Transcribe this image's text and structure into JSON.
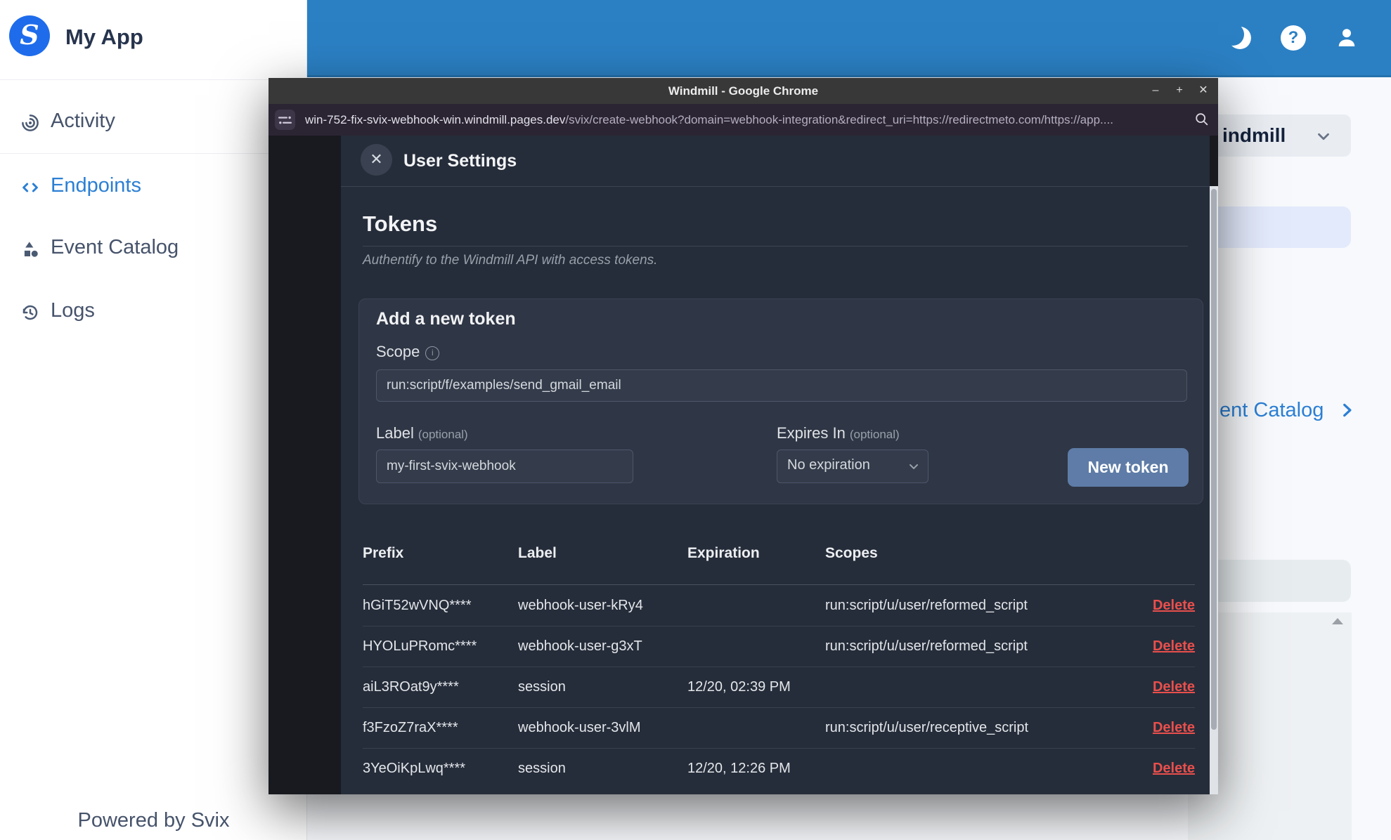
{
  "sidebar": {
    "app_name": "My App",
    "items": [
      {
        "label": "Activity",
        "icon": "activity-icon",
        "active": false
      },
      {
        "label": "Endpoints",
        "icon": "endpoints-icon",
        "active": true
      },
      {
        "label": "Event Catalog",
        "icon": "event-catalog-icon",
        "active": false
      },
      {
        "label": "Logs",
        "icon": "logs-icon",
        "active": false
      }
    ],
    "footer": "Powered by Svix"
  },
  "topbar": {
    "icons": [
      "moon-icon",
      "help-icon",
      "user-icon"
    ],
    "help_glyph": "?"
  },
  "background_page": {
    "workspace_label": "indmill",
    "catalog_link": "ent Catalog"
  },
  "window": {
    "title": "Windmill - Google Chrome",
    "controls": {
      "minimize": "–",
      "maximize": "+",
      "close": "✕"
    },
    "url": {
      "domain": "win-752-fix-svix-webhook-win.windmill.pages.dev",
      "path": "/svix/create-webhook?domain=webhook-integration&redirect_uri=https://redirectmeto.com/https://app...."
    }
  },
  "modal": {
    "title": "User Settings",
    "close_glyph": "✕",
    "section": {
      "heading": "Tokens",
      "subtitle": "Authentify to the Windmill API with access tokens."
    },
    "add_token": {
      "heading": "Add a new token",
      "scope_label": "Scope",
      "info_glyph": "i",
      "scope_value": "run:script/f/examples/send_gmail_email",
      "label_label": "Label",
      "label_optional": "(optional)",
      "label_value": "my-first-svix-webhook",
      "expires_label": "Expires In",
      "expires_optional": "(optional)",
      "expires_value": "No expiration",
      "submit_label": "New token"
    },
    "table": {
      "headers": [
        "Prefix",
        "Label",
        "Expiration",
        "Scopes"
      ],
      "delete_label": "Delete",
      "rows": [
        {
          "prefix": "hGiT52wVNQ****",
          "label": "webhook-user-kRy4",
          "expiration": "",
          "scopes": "run:script/u/user/reformed_script"
        },
        {
          "prefix": "HYOLuPRomc****",
          "label": "webhook-user-g3xT",
          "expiration": "",
          "scopes": "run:script/u/user/reformed_script"
        },
        {
          "prefix": "aiL3ROat9y****",
          "label": "session",
          "expiration": "12/20, 02:39 PM",
          "scopes": ""
        },
        {
          "prefix": "f3FzoZ7raX****",
          "label": "webhook-user-3vlM",
          "expiration": "",
          "scopes": "run:script/u/user/receptive_script"
        },
        {
          "prefix": "3YeOiKpLwq****",
          "label": "session",
          "expiration": "12/20, 12:26 PM",
          "scopes": ""
        }
      ]
    }
  },
  "colors": {
    "topbar_blue": "#2b80c4",
    "accent_blue": "#2b7fd4",
    "logo_blue": "#1e6ceb",
    "modal_bg": "#262d3a",
    "button_blue": "#5e7ca7",
    "delete_red": "#ea4f4c"
  }
}
